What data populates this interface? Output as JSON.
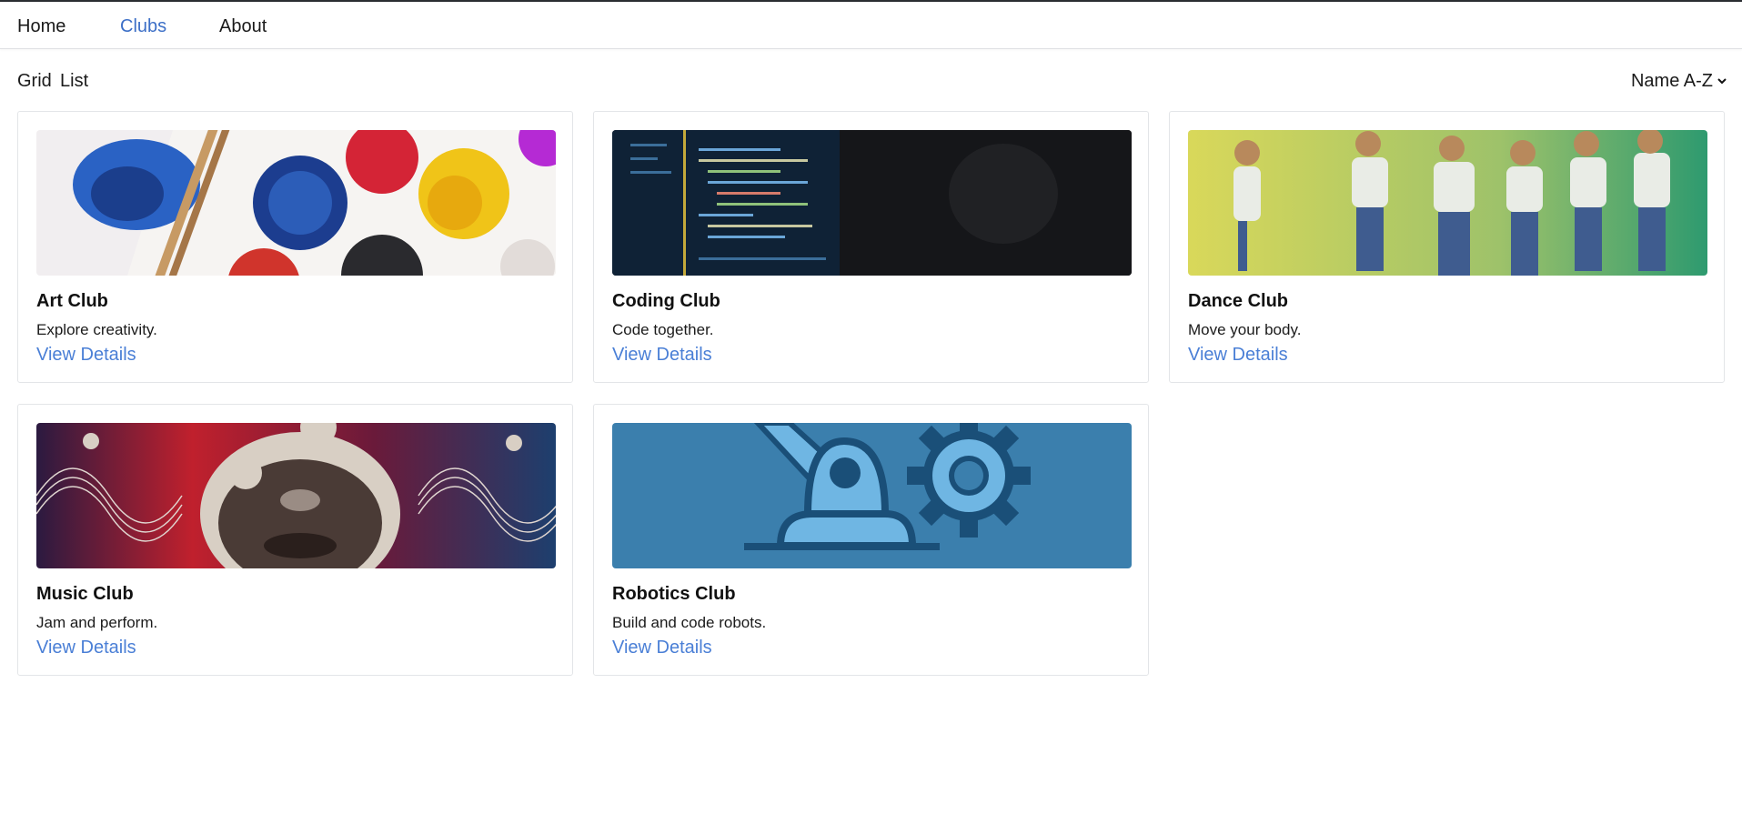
{
  "nav": {
    "items": [
      {
        "label": "Home",
        "active": false
      },
      {
        "label": "Clubs",
        "active": true
      },
      {
        "label": "About",
        "active": false
      }
    ]
  },
  "toolbar": {
    "grid_label": "Grid",
    "list_label": "List",
    "sort_value": "Name A-Z",
    "sort_icon": "chevron-down-icon"
  },
  "clubs": [
    {
      "title": "Art Club",
      "description": "Explore creativity.",
      "link": "View Details",
      "image": "paint-palette-photo"
    },
    {
      "title": "Coding Club",
      "description": "Code together.",
      "link": "View Details",
      "image": "code-screen-photo"
    },
    {
      "title": "Dance Club",
      "description": "Move your body.",
      "link": "View Details",
      "image": "dancers-photo"
    },
    {
      "title": "Music Club",
      "description": "Jam and perform.",
      "link": "View Details",
      "image": "music-face-art"
    },
    {
      "title": "Robotics Club",
      "description": "Build and code robots.",
      "link": "View Details",
      "image": "robot-arm-gear-illustration"
    }
  ],
  "colors": {
    "accent": "#4a7fd6",
    "active_nav": "#3c6fc7",
    "border": "#e3e5e8"
  }
}
